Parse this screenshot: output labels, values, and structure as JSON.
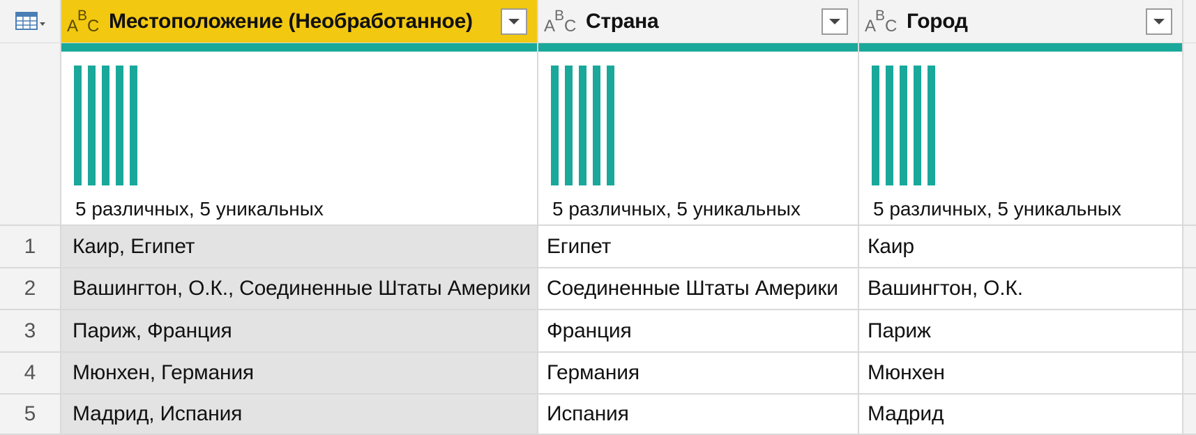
{
  "columns": [
    {
      "type_icon": "abc-text-type-icon",
      "title": "Местоположение (Необработанное)",
      "selected": true
    },
    {
      "type_icon": "abc-text-type-icon",
      "title": "Страна",
      "selected": false
    },
    {
      "type_icon": "abc-text-type-icon",
      "title": "Город",
      "selected": false
    }
  ],
  "type_icon_letters": {
    "a": "A",
    "b": "B",
    "c": "C"
  },
  "profiles": [
    {
      "summary": "5 различных, 5 уникальных",
      "distinct": 5,
      "unique": 5
    },
    {
      "summary": "5 различных, 5 уникальных",
      "distinct": 5,
      "unique": 5
    },
    {
      "summary": "5 различных, 5 уникальных",
      "distinct": 5,
      "unique": 5
    }
  ],
  "rows": [
    {
      "num": "1",
      "cells": [
        "Каир, Египет",
        "Египет",
        "Каир"
      ]
    },
    {
      "num": "2",
      "cells": [
        "Вашингтон, О.К., Соединенные Штаты Америки",
        "Соединенные Штаты Америки",
        "Вашингтон, О.К."
      ]
    },
    {
      "num": "3",
      "cells": [
        "Париж, Франция",
        "Франция",
        "Париж"
      ]
    },
    {
      "num": "4",
      "cells": [
        "Мюнхен, Германия",
        "Германия",
        "Мюнхен"
      ]
    },
    {
      "num": "5",
      "cells": [
        "Мадрид, Испания",
        "Испания",
        "Мадрид"
      ]
    }
  ],
  "icons": {
    "corner": "table-menu-icon",
    "dropdown": "chevron-down-icon"
  },
  "colors": {
    "selected_header": "#f2c811",
    "quality_bar": "#1aa89a",
    "selected_column_bg": "#e3e3e3",
    "gutter": "#f3f3f3"
  }
}
